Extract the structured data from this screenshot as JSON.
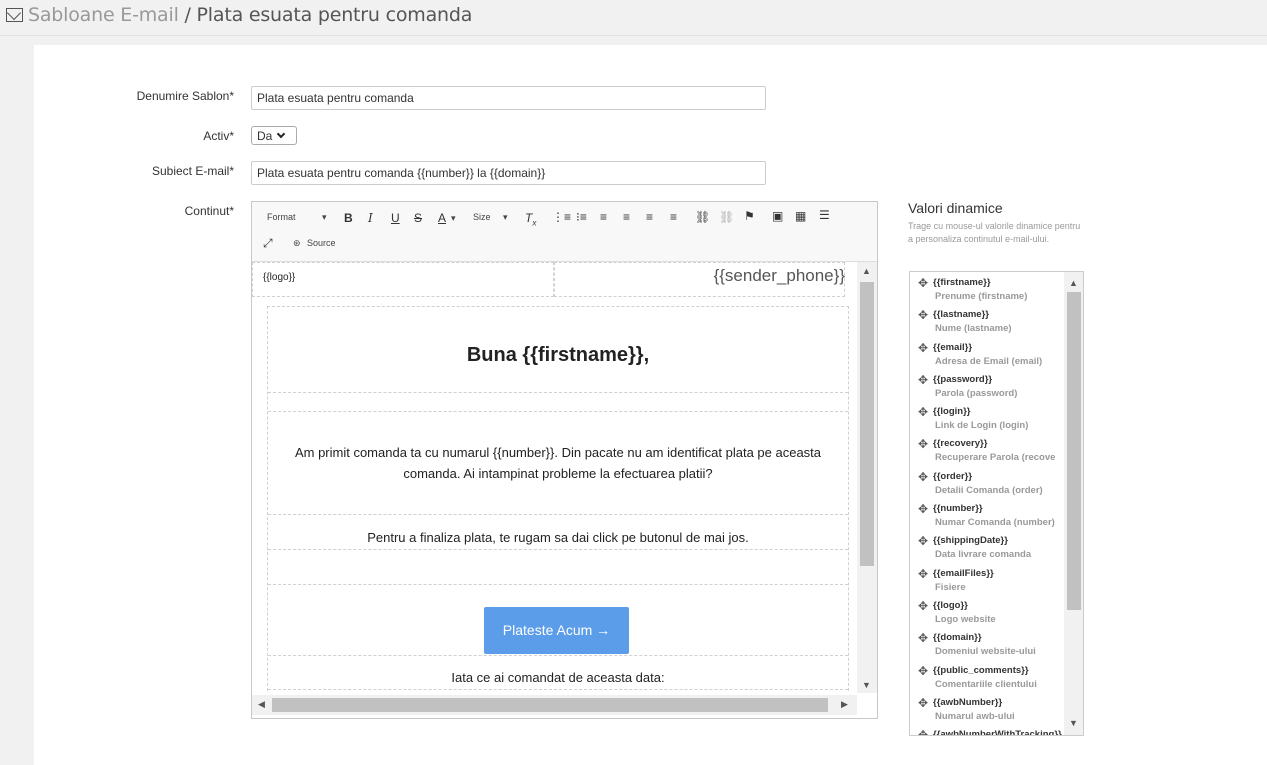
{
  "breadcrumb": {
    "section": "Sabloane E-mail",
    "separator": " / ",
    "current": "Plata esuata pentru comanda"
  },
  "form": {
    "name_label": "Denumire Sablon*",
    "name_value": "Plata esuata pentru comanda",
    "active_label": "Activ*",
    "active_value": "Da",
    "subject_label": "Subiect E-mail*",
    "subject_value": "Plata esuata pentru comanda {{number}} la {{domain}}",
    "content_label": "Continut*"
  },
  "toolbar": {
    "format": "Format",
    "size": "Size",
    "source": "Source"
  },
  "email": {
    "logo": "{{logo}}",
    "sender_phone": "{{sender_phone}}",
    "greeting": "Buna {{firstname}},",
    "paragraph": "Am primit comanda ta cu numarul {{number}}. Din pacate nu am identificat plata pe aceasta comanda. Ai intampinat probleme la efectuarea platii?",
    "instruction": "Pentru a finaliza plata, te rugam sa dai click pe butonul de mai jos.",
    "button": "Plateste Acum →",
    "ordered": "Iata ce ai comandat de aceasta data:"
  },
  "dynamic": {
    "title": "Valori dinamice",
    "hint": "Trage cu mouse-ul valorile dinamice pentru a personaliza continutul e-mail-ului.",
    "items": [
      {
        "token": "{{firstname}}",
        "desc": "Prenume (firstname)"
      },
      {
        "token": "{{lastname}}",
        "desc": "Nume (lastname)"
      },
      {
        "token": "{{email}}",
        "desc": "Adresa de Email (email)"
      },
      {
        "token": "{{password}}",
        "desc": "Parola (password)"
      },
      {
        "token": "{{login}}",
        "desc": "Link de Login (login)"
      },
      {
        "token": "{{recovery}}",
        "desc": "Recuperare Parola (recove"
      },
      {
        "token": "{{order}}",
        "desc": "Detalii Comanda (order)"
      },
      {
        "token": "{{number}}",
        "desc": "Numar Comanda (number)"
      },
      {
        "token": "{{shippingDate}}",
        "desc": "Data livrare comanda"
      },
      {
        "token": "{{emailFiles}}",
        "desc": "Fisiere"
      },
      {
        "token": "{{logo}}",
        "desc": "Logo website"
      },
      {
        "token": "{{domain}}",
        "desc": "Domeniul website-ului"
      },
      {
        "token": "{{public_comments}}",
        "desc": "Comentariile clientului"
      },
      {
        "token": "{{awbNumber}}",
        "desc": "Numarul awb-ului"
      },
      {
        "token": "{{awbNumberWithTracking}}",
        "desc": ""
      }
    ]
  }
}
